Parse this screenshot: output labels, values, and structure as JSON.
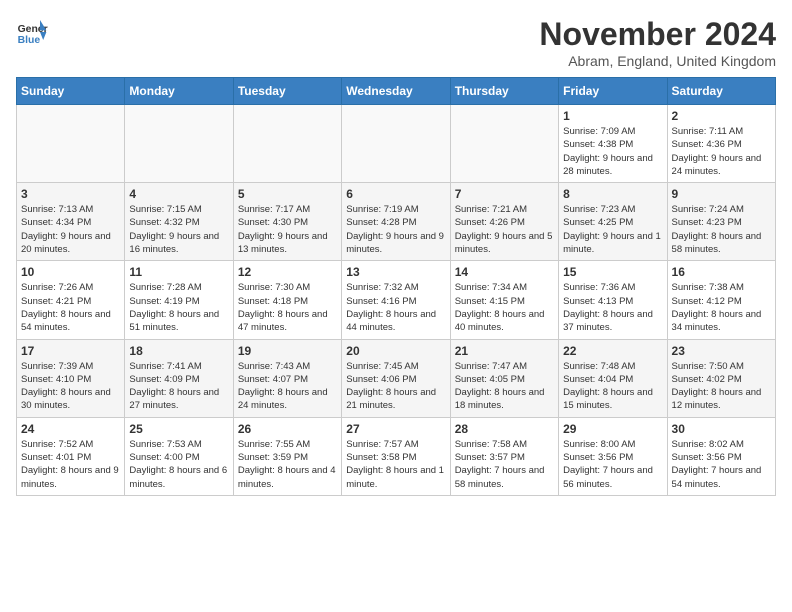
{
  "logo": {
    "general": "General",
    "blue": "Blue"
  },
  "header": {
    "month": "November 2024",
    "location": "Abram, England, United Kingdom"
  },
  "days_of_week": [
    "Sunday",
    "Monday",
    "Tuesday",
    "Wednesday",
    "Thursday",
    "Friday",
    "Saturday"
  ],
  "weeks": [
    [
      {
        "day": "",
        "info": ""
      },
      {
        "day": "",
        "info": ""
      },
      {
        "day": "",
        "info": ""
      },
      {
        "day": "",
        "info": ""
      },
      {
        "day": "",
        "info": ""
      },
      {
        "day": "1",
        "info": "Sunrise: 7:09 AM\nSunset: 4:38 PM\nDaylight: 9 hours and 28 minutes."
      },
      {
        "day": "2",
        "info": "Sunrise: 7:11 AM\nSunset: 4:36 PM\nDaylight: 9 hours and 24 minutes."
      }
    ],
    [
      {
        "day": "3",
        "info": "Sunrise: 7:13 AM\nSunset: 4:34 PM\nDaylight: 9 hours and 20 minutes."
      },
      {
        "day": "4",
        "info": "Sunrise: 7:15 AM\nSunset: 4:32 PM\nDaylight: 9 hours and 16 minutes."
      },
      {
        "day": "5",
        "info": "Sunrise: 7:17 AM\nSunset: 4:30 PM\nDaylight: 9 hours and 13 minutes."
      },
      {
        "day": "6",
        "info": "Sunrise: 7:19 AM\nSunset: 4:28 PM\nDaylight: 9 hours and 9 minutes."
      },
      {
        "day": "7",
        "info": "Sunrise: 7:21 AM\nSunset: 4:26 PM\nDaylight: 9 hours and 5 minutes."
      },
      {
        "day": "8",
        "info": "Sunrise: 7:23 AM\nSunset: 4:25 PM\nDaylight: 9 hours and 1 minute."
      },
      {
        "day": "9",
        "info": "Sunrise: 7:24 AM\nSunset: 4:23 PM\nDaylight: 8 hours and 58 minutes."
      }
    ],
    [
      {
        "day": "10",
        "info": "Sunrise: 7:26 AM\nSunset: 4:21 PM\nDaylight: 8 hours and 54 minutes."
      },
      {
        "day": "11",
        "info": "Sunrise: 7:28 AM\nSunset: 4:19 PM\nDaylight: 8 hours and 51 minutes."
      },
      {
        "day": "12",
        "info": "Sunrise: 7:30 AM\nSunset: 4:18 PM\nDaylight: 8 hours and 47 minutes."
      },
      {
        "day": "13",
        "info": "Sunrise: 7:32 AM\nSunset: 4:16 PM\nDaylight: 8 hours and 44 minutes."
      },
      {
        "day": "14",
        "info": "Sunrise: 7:34 AM\nSunset: 4:15 PM\nDaylight: 8 hours and 40 minutes."
      },
      {
        "day": "15",
        "info": "Sunrise: 7:36 AM\nSunset: 4:13 PM\nDaylight: 8 hours and 37 minutes."
      },
      {
        "day": "16",
        "info": "Sunrise: 7:38 AM\nSunset: 4:12 PM\nDaylight: 8 hours and 34 minutes."
      }
    ],
    [
      {
        "day": "17",
        "info": "Sunrise: 7:39 AM\nSunset: 4:10 PM\nDaylight: 8 hours and 30 minutes."
      },
      {
        "day": "18",
        "info": "Sunrise: 7:41 AM\nSunset: 4:09 PM\nDaylight: 8 hours and 27 minutes."
      },
      {
        "day": "19",
        "info": "Sunrise: 7:43 AM\nSunset: 4:07 PM\nDaylight: 8 hours and 24 minutes."
      },
      {
        "day": "20",
        "info": "Sunrise: 7:45 AM\nSunset: 4:06 PM\nDaylight: 8 hours and 21 minutes."
      },
      {
        "day": "21",
        "info": "Sunrise: 7:47 AM\nSunset: 4:05 PM\nDaylight: 8 hours and 18 minutes."
      },
      {
        "day": "22",
        "info": "Sunrise: 7:48 AM\nSunset: 4:04 PM\nDaylight: 8 hours and 15 minutes."
      },
      {
        "day": "23",
        "info": "Sunrise: 7:50 AM\nSunset: 4:02 PM\nDaylight: 8 hours and 12 minutes."
      }
    ],
    [
      {
        "day": "24",
        "info": "Sunrise: 7:52 AM\nSunset: 4:01 PM\nDaylight: 8 hours and 9 minutes."
      },
      {
        "day": "25",
        "info": "Sunrise: 7:53 AM\nSunset: 4:00 PM\nDaylight: 8 hours and 6 minutes."
      },
      {
        "day": "26",
        "info": "Sunrise: 7:55 AM\nSunset: 3:59 PM\nDaylight: 8 hours and 4 minutes."
      },
      {
        "day": "27",
        "info": "Sunrise: 7:57 AM\nSunset: 3:58 PM\nDaylight: 8 hours and 1 minute."
      },
      {
        "day": "28",
        "info": "Sunrise: 7:58 AM\nSunset: 3:57 PM\nDaylight: 7 hours and 58 minutes."
      },
      {
        "day": "29",
        "info": "Sunrise: 8:00 AM\nSunset: 3:56 PM\nDaylight: 7 hours and 56 minutes."
      },
      {
        "day": "30",
        "info": "Sunrise: 8:02 AM\nSunset: 3:56 PM\nDaylight: 7 hours and 54 minutes."
      }
    ]
  ]
}
